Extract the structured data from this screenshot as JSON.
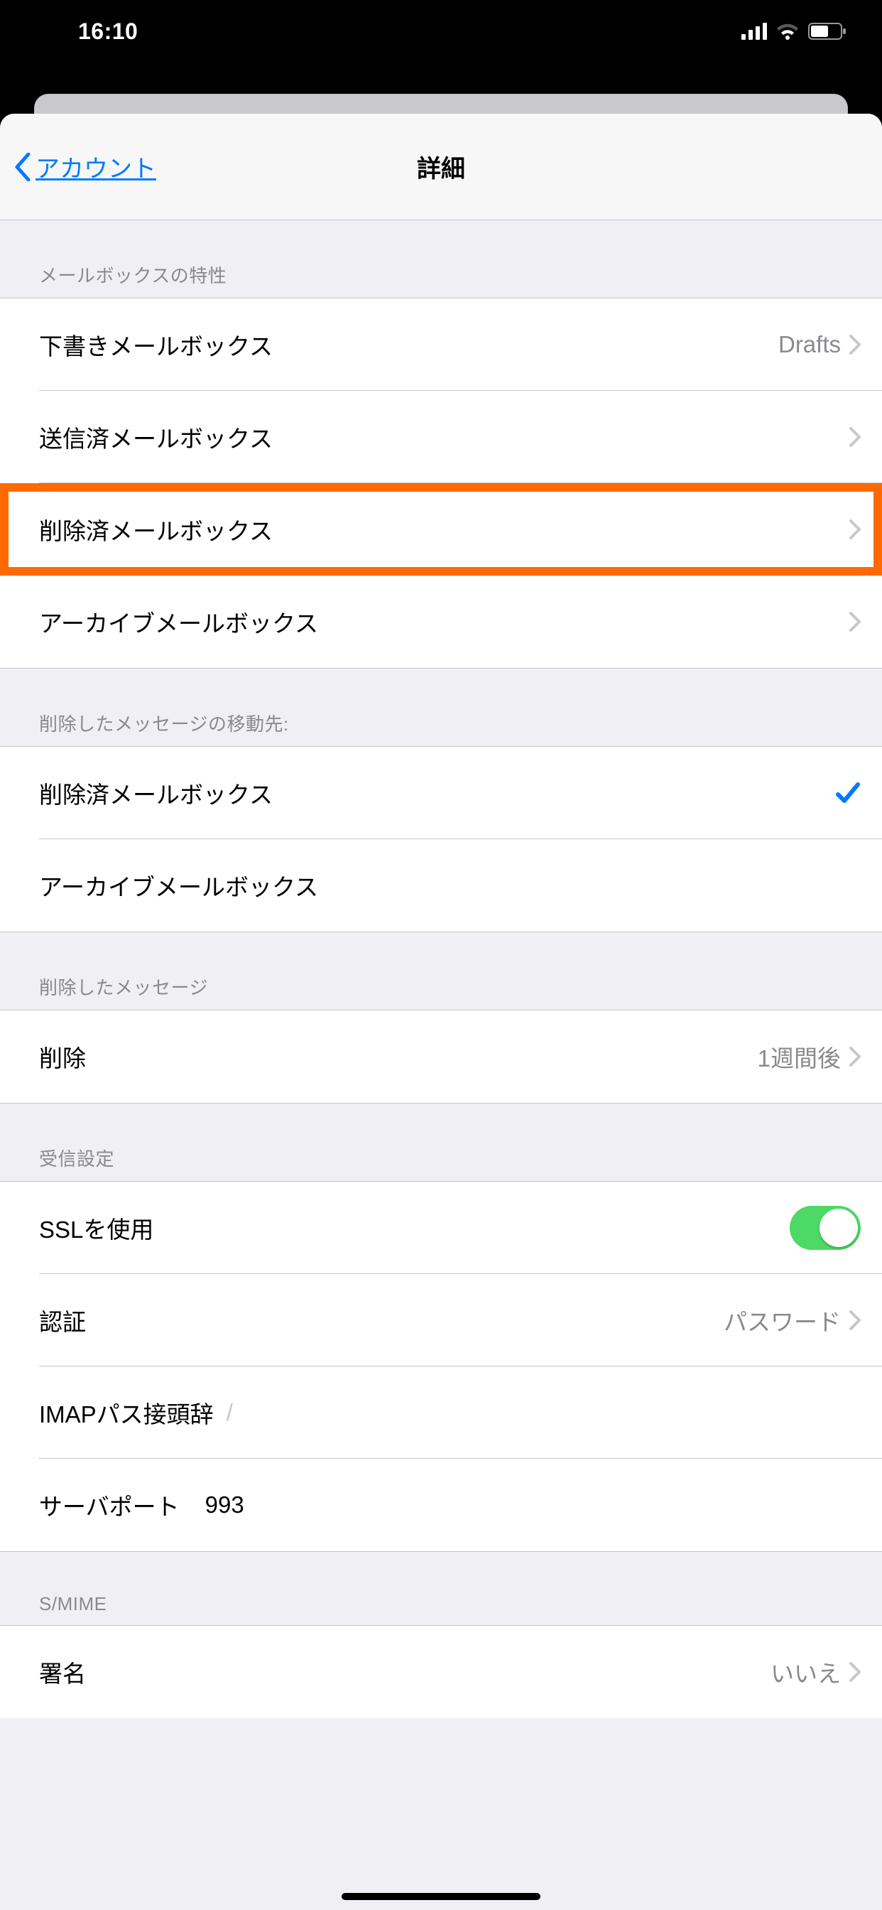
{
  "status": {
    "time": "16:10"
  },
  "nav": {
    "back_label": "アカウント",
    "title": "詳細"
  },
  "mailbox_behavior": {
    "header": "メールボックスの特性",
    "drafts_label": "下書きメールボックス",
    "drafts_value": "Drafts",
    "sent_label": "送信済メールボックス",
    "deleted_label": "削除済メールボックス",
    "archive_label": "アーカイブメールボックス"
  },
  "move_discarded": {
    "header": "削除したメッセージの移動先:",
    "deleted_label": "削除済メールボックス",
    "archive_label": "アーカイブメールボックス",
    "selected": "deleted"
  },
  "deleted_messages": {
    "header": "削除したメッセージ",
    "remove_label": "削除",
    "remove_value": "1週間後"
  },
  "incoming": {
    "header": "受信設定",
    "ssl_label": "SSLを使用",
    "ssl_on": true,
    "auth_label": "認証",
    "auth_value": "パスワード",
    "imap_prefix_label": "IMAPパス接頭辞",
    "imap_prefix_placeholder": "/",
    "port_label": "サーバポート",
    "port_value": "993"
  },
  "smime": {
    "header": "S/MIME",
    "sign_label": "署名",
    "sign_value": "いいえ"
  }
}
